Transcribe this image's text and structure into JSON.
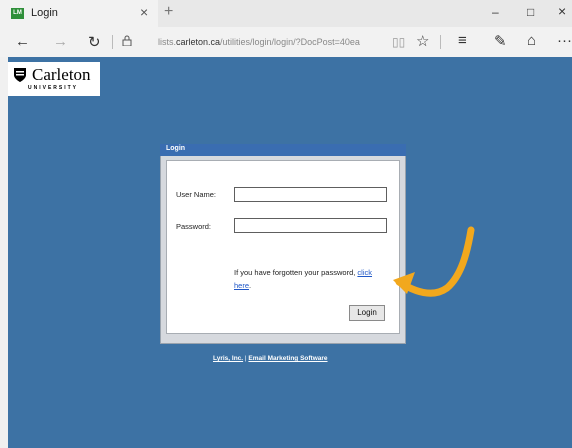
{
  "browser": {
    "tab_favicon": "LM",
    "tab_title": "Login",
    "tab_close": "×",
    "new_tab": "+",
    "minimize": "–",
    "maximize": "□",
    "close": "×",
    "url_domain": "lists.carleton.ca",
    "url_path": "/utilities/login/login/?DocPost=40ea",
    "url_prefix": "lists."
  },
  "logo": {
    "name": "Carleton",
    "sub": "UNIVERSITY"
  },
  "dialog": {
    "title": "Login",
    "username_label": "User Name:",
    "password_label": "Password:",
    "forgot_text": "If you have forgotten your password,",
    "forgot_link": "click here",
    "forgot_link_1": "click",
    "forgot_link_2": "here",
    "login_button": "Login"
  },
  "footer": {
    "link1": "Lyris, Inc.",
    "separator": " | ",
    "link2": "Email Marketing Software"
  },
  "colors": {
    "page_bg": "#3d72a4",
    "dialog_header": "#3a6db1",
    "arrow": "#f2a81d"
  }
}
